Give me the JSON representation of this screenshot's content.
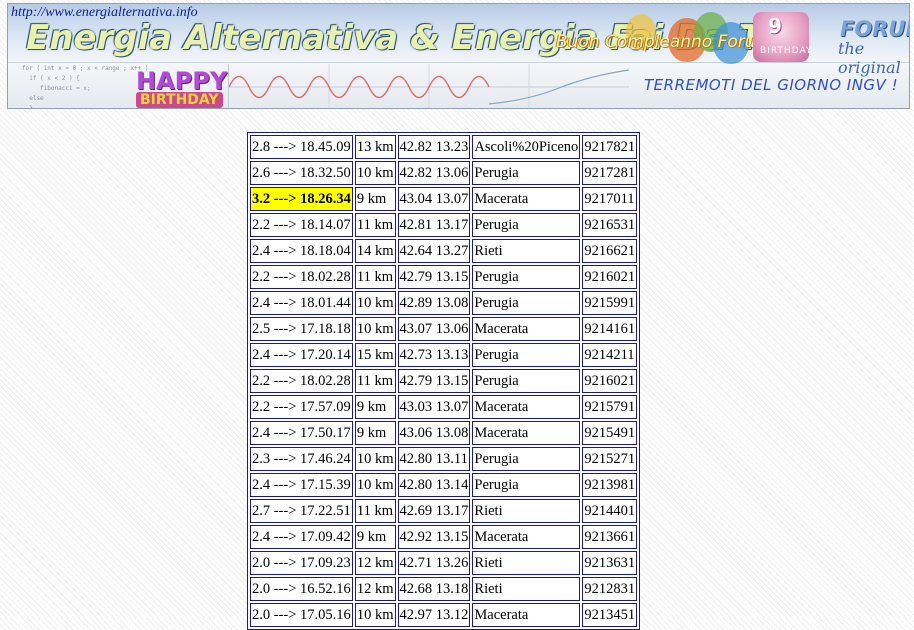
{
  "banner": {
    "url": "http://www.energialternativa.info",
    "title": "Energia Alternativa & Energia Fai Da Te",
    "birthday_text": "Buon Compleanno Forum",
    "cake_number": "9",
    "cake_label": "BIRTHDAY",
    "forum_label": "FORUM",
    "forum_sub": "the original",
    "happy": "HAPPY",
    "birthday": "BIRTHDAY",
    "marquee": "TERREMOTI DEL GIORNO INGV !"
  },
  "quakes": {
    "highlighted_row": 2,
    "highlight_color": "#ffff00",
    "rows": [
      {
        "event": "2.8 ---> 18.45.09",
        "depth": "13 km",
        "coords": "42.82 13.23",
        "place": "Ascoli%20Piceno",
        "id": "9217821"
      },
      {
        "event": "2.6 ---> 18.32.50",
        "depth": "10 km",
        "coords": "42.82 13.06",
        "place": "Perugia",
        "id": "9217281"
      },
      {
        "event": "3.2 ---> 18.26.34",
        "depth": "9 km",
        "coords": "43.04 13.07",
        "place": "Macerata",
        "id": "9217011"
      },
      {
        "event": "2.2 ---> 18.14.07",
        "depth": "11 km",
        "coords": "42.81 13.17",
        "place": "Perugia",
        "id": "9216531"
      },
      {
        "event": "2.4 ---> 18.18.04",
        "depth": "14 km",
        "coords": "42.64 13.27",
        "place": "Rieti",
        "id": "9216621"
      },
      {
        "event": "2.2 ---> 18.02.28",
        "depth": "11 km",
        "coords": "42.79 13.15",
        "place": "Perugia",
        "id": "9216021"
      },
      {
        "event": "2.4 ---> 18.01.44",
        "depth": "10 km",
        "coords": "42.89 13.08",
        "place": "Perugia",
        "id": "9215991"
      },
      {
        "event": "2.5 ---> 17.18.18",
        "depth": "10 km",
        "coords": "43.07 13.06",
        "place": "Macerata",
        "id": "9214161"
      },
      {
        "event": "2.4 ---> 17.20.14",
        "depth": "15 km",
        "coords": "42.73 13.13",
        "place": "Perugia",
        "id": "9214211"
      },
      {
        "event": "2.2 ---> 18.02.28",
        "depth": "11 km",
        "coords": "42.79 13.15",
        "place": "Perugia",
        "id": "9216021"
      },
      {
        "event": "2.2 ---> 17.57.09",
        "depth": "9 km",
        "coords": "43.03 13.07",
        "place": "Macerata",
        "id": "9215791"
      },
      {
        "event": "2.4 ---> 17.50.17",
        "depth": "9 km",
        "coords": "43.06 13.08",
        "place": "Macerata",
        "id": "9215491"
      },
      {
        "event": "2.3 ---> 17.46.24",
        "depth": "10 km",
        "coords": "42.80 13.11",
        "place": "Perugia",
        "id": "9215271"
      },
      {
        "event": "2.4 ---> 17.15.39",
        "depth": "10 km",
        "coords": "42.80 13.14",
        "place": "Perugia",
        "id": "9213981"
      },
      {
        "event": "2.7 ---> 17.22.51",
        "depth": "11 km",
        "coords": "42.69 13.17",
        "place": "Rieti",
        "id": "9214401"
      },
      {
        "event": "2.4 ---> 17.09.42",
        "depth": "9 km",
        "coords": "42.92 13.15",
        "place": "Macerata",
        "id": "9213661"
      },
      {
        "event": "2.0 ---> 17.09.23",
        "depth": "12 km",
        "coords": "42.71 13.26",
        "place": "Rieti",
        "id": "9213631"
      },
      {
        "event": "2.0 ---> 16.52.16",
        "depth": "12 km",
        "coords": "42.68 13.18",
        "place": "Rieti",
        "id": "9212831"
      },
      {
        "event": "2.0 ---> 17.05.16",
        "depth": "10 km",
        "coords": "42.97 13.12",
        "place": "Macerata",
        "id": "9213451"
      }
    ]
  }
}
